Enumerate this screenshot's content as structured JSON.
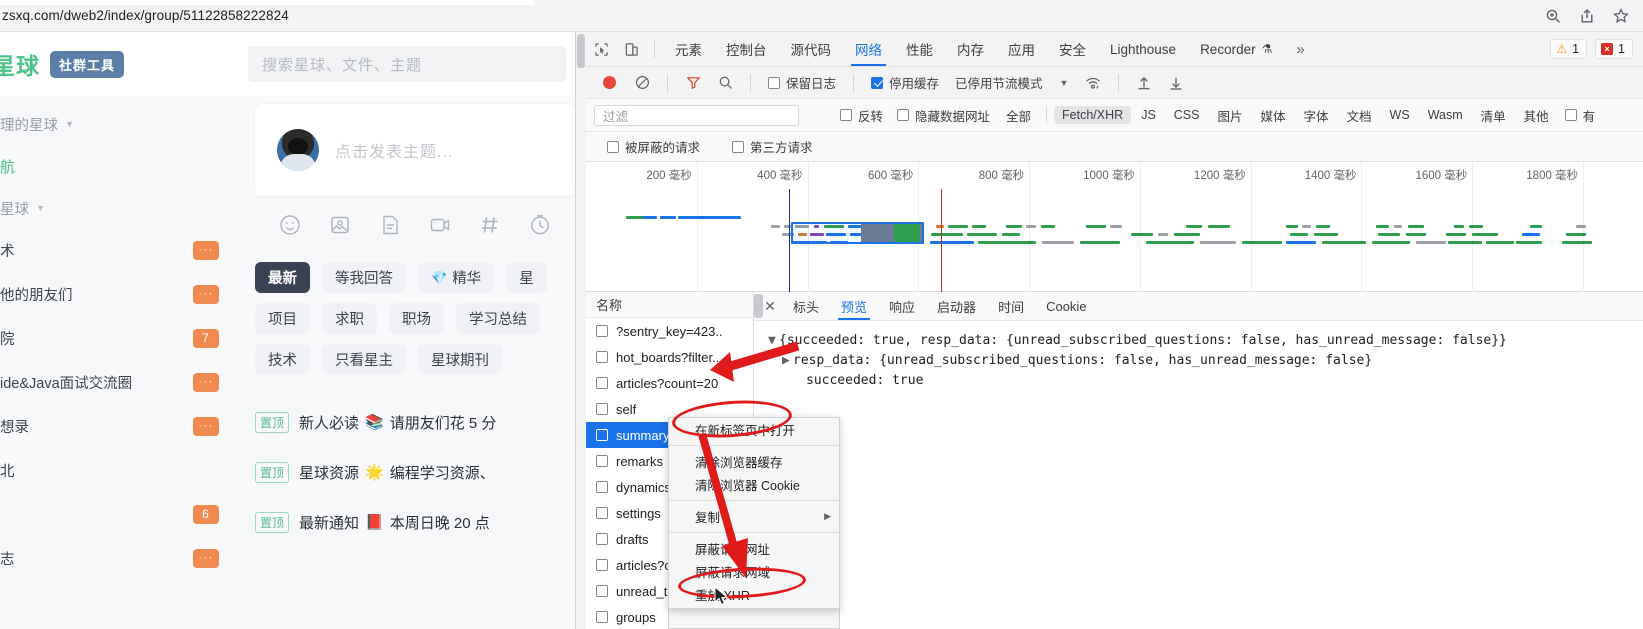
{
  "browser": {
    "url": "zsxq.com/dweb2/index/group/51122858222824",
    "icons": [
      "zoom-icon",
      "share-icon",
      "bookmark-star-icon"
    ]
  },
  "page": {
    "brand": "星球",
    "brand_badge": "社群工具",
    "search_placeholder": "搜索星球、文件、主题",
    "sidebar": {
      "group_title": "理的星球",
      "nav_link": "航",
      "section_title": "星球",
      "items": [
        {
          "label": "术",
          "badge": "···",
          "badge_type": "dots"
        },
        {
          "label": "他的朋友们",
          "badge": "···",
          "badge_type": "dots"
        },
        {
          "label": "院",
          "badge": "7",
          "badge_type": "count"
        },
        {
          "label": "ide&Java面试交流圈",
          "badge": "···",
          "badge_type": "dots"
        },
        {
          "label": "想录",
          "badge": "···",
          "badge_type": "dots"
        },
        {
          "label": "北",
          "badge": "",
          "badge_type": "none"
        },
        {
          "label": "",
          "badge": "6",
          "badge_type": "count"
        },
        {
          "label": "志",
          "badge": "···",
          "badge_type": "dots"
        }
      ]
    },
    "composer": {
      "placeholder": "点击发表主题...",
      "tools": [
        "emoji-icon",
        "image-icon",
        "file-icon",
        "video-icon",
        "hashtag-icon",
        "clock-icon"
      ]
    },
    "tabs": [
      {
        "label": "最新",
        "active": true,
        "gem": ""
      },
      {
        "label": "等我回答",
        "active": false,
        "gem": ""
      },
      {
        "label": "精华",
        "active": false,
        "gem": "💎"
      },
      {
        "label": "星",
        "active": false,
        "gem": ""
      },
      {
        "label": "项目",
        "active": false,
        "gem": ""
      },
      {
        "label": "求职",
        "active": false,
        "gem": ""
      },
      {
        "label": "职场",
        "active": false,
        "gem": ""
      },
      {
        "label": "学习总结",
        "active": false,
        "gem": ""
      },
      {
        "label": "技术",
        "active": false,
        "gem": ""
      },
      {
        "label": "只看星主",
        "active": false,
        "gem": ""
      },
      {
        "label": "星球期刊",
        "active": false,
        "gem": ""
      }
    ],
    "posts": [
      {
        "pin": "置顶",
        "title": "新人必读",
        "emoji": "📚",
        "text": "请朋友们花 5 分"
      },
      {
        "pin": "置顶",
        "title": "星球资源",
        "emoji": "🌟",
        "text": "编程学习资源、"
      },
      {
        "pin": "置顶",
        "title": "最新通知",
        "emoji": "📕",
        "text": "本周日晚 20 点"
      }
    ]
  },
  "devtools": {
    "tabs": [
      {
        "label": "元素",
        "active": false
      },
      {
        "label": "控制台",
        "active": false
      },
      {
        "label": "源代码",
        "active": false
      },
      {
        "label": "网络",
        "active": true
      },
      {
        "label": "性能",
        "active": false
      },
      {
        "label": "内存",
        "active": false
      },
      {
        "label": "应用",
        "active": false
      },
      {
        "label": "安全",
        "active": false
      },
      {
        "label": "Lighthouse",
        "active": false
      },
      {
        "label": "Recorder",
        "active": false,
        "flask": "⚗"
      }
    ],
    "more_label": "»",
    "warning_count": "1",
    "error_count": "1",
    "toolbar": {
      "record_label": "record-button",
      "clear_label": "clear-button",
      "filter_label": "filter-button",
      "search_label": "search-button",
      "preserve_log": "保留日志",
      "preserve_log_checked": false,
      "disable_cache": "停用缓存",
      "disable_cache_checked": true,
      "throttling": "已停用节流模式"
    },
    "filterbar": {
      "filter_placeholder": "过滤",
      "invert": "反转",
      "hide_data_urls": "隐藏数据网址",
      "types": [
        "全部",
        "Fetch/XHR",
        "JS",
        "CSS",
        "图片",
        "媒体",
        "字体",
        "文档",
        "WS",
        "Wasm",
        "清单",
        "其他"
      ],
      "selected_type": "Fetch/XHR",
      "has_blocked": "有",
      "blocked_requests": "被屏蔽的请求",
      "third_party": "第三方请求"
    },
    "timeline_ticks": [
      "200 毫秒",
      "400 毫秒",
      "600 毫秒",
      "800 毫秒",
      "1000 毫秒",
      "1200 毫秒",
      "1400 毫秒",
      "1600 毫秒",
      "1800 毫秒"
    ],
    "requests": {
      "header": "名称",
      "items": [
        {
          "name": "?sentry_key=423..",
          "selected": false
        },
        {
          "name": "hot_boards?filter..",
          "selected": false
        },
        {
          "name": "articles?count=20",
          "selected": false
        },
        {
          "name": "self",
          "selected": false
        },
        {
          "name": "summary",
          "selected": true
        },
        {
          "name": "remarks",
          "selected": false
        },
        {
          "name": "dynamics?",
          "selected": false
        },
        {
          "name": "settings",
          "selected": false
        },
        {
          "name": "drafts",
          "selected": false
        },
        {
          "name": "articles?cc",
          "selected": false
        },
        {
          "name": "unread_to",
          "selected": false
        },
        {
          "name": "groups",
          "selected": false
        }
      ]
    },
    "detail_tabs": [
      {
        "label": "标头",
        "active": false
      },
      {
        "label": "预览",
        "active": true
      },
      {
        "label": "响应",
        "active": false
      },
      {
        "label": "启动器",
        "active": false
      },
      {
        "label": "时间",
        "active": false
      },
      {
        "label": "Cookie",
        "active": false
      }
    ],
    "preview": {
      "line1": "{succeeded: true, resp_data: {unread_subscribed_questions: false, has_unread_message: false}}",
      "line2": "resp_data: {unread_subscribed_questions: false, has_unread_message: false}",
      "line3": "succeeded: true"
    },
    "context_menu": [
      {
        "label": "在新标签页中打开",
        "submenu": false,
        "sep_after": true
      },
      {
        "label": "清除浏览器缓存",
        "submenu": false,
        "sep_after": false
      },
      {
        "label": "清除浏览器 Cookie",
        "submenu": false,
        "sep_after": true
      },
      {
        "label": "复制",
        "submenu": true,
        "sep_after": true
      },
      {
        "label": "屏蔽请求网址",
        "submenu": false,
        "sep_after": false
      },
      {
        "label": "屏蔽请求网域",
        "submenu": false,
        "sep_after": false
      },
      {
        "label": "重放 XHR",
        "submenu": false,
        "sep_after": false
      }
    ]
  },
  "colors": {
    "accent_blue": "#1a73e8",
    "record_red": "#e8453c",
    "brand_green": "#4cc38a",
    "badge_orange": "#f08a50",
    "annotation_red": "#e01b1b"
  }
}
